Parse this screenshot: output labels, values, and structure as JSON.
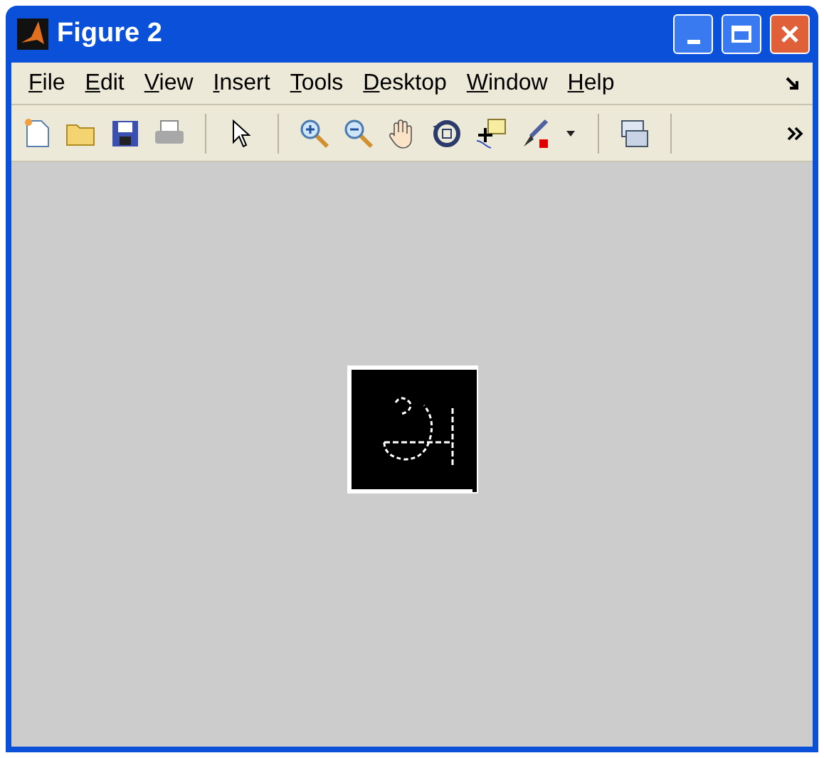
{
  "window": {
    "title": "Figure 2"
  },
  "menu": [
    "File",
    "Edit",
    "View",
    "Insert",
    "Tools",
    "Desktop",
    "Window",
    "Help"
  ],
  "toolbar": [
    {
      "kind": "new"
    },
    {
      "kind": "open"
    },
    {
      "kind": "save"
    },
    {
      "kind": "print"
    },
    {
      "kind": "sep"
    },
    {
      "kind": "pointer"
    },
    {
      "kind": "sep"
    },
    {
      "kind": "zoom-in"
    },
    {
      "kind": "zoom-out"
    },
    {
      "kind": "pan"
    },
    {
      "kind": "rotate"
    },
    {
      "kind": "datatip"
    },
    {
      "kind": "brush"
    },
    {
      "kind": "dropdown"
    },
    {
      "kind": "sep"
    },
    {
      "kind": "link"
    },
    {
      "kind": "sep"
    }
  ]
}
